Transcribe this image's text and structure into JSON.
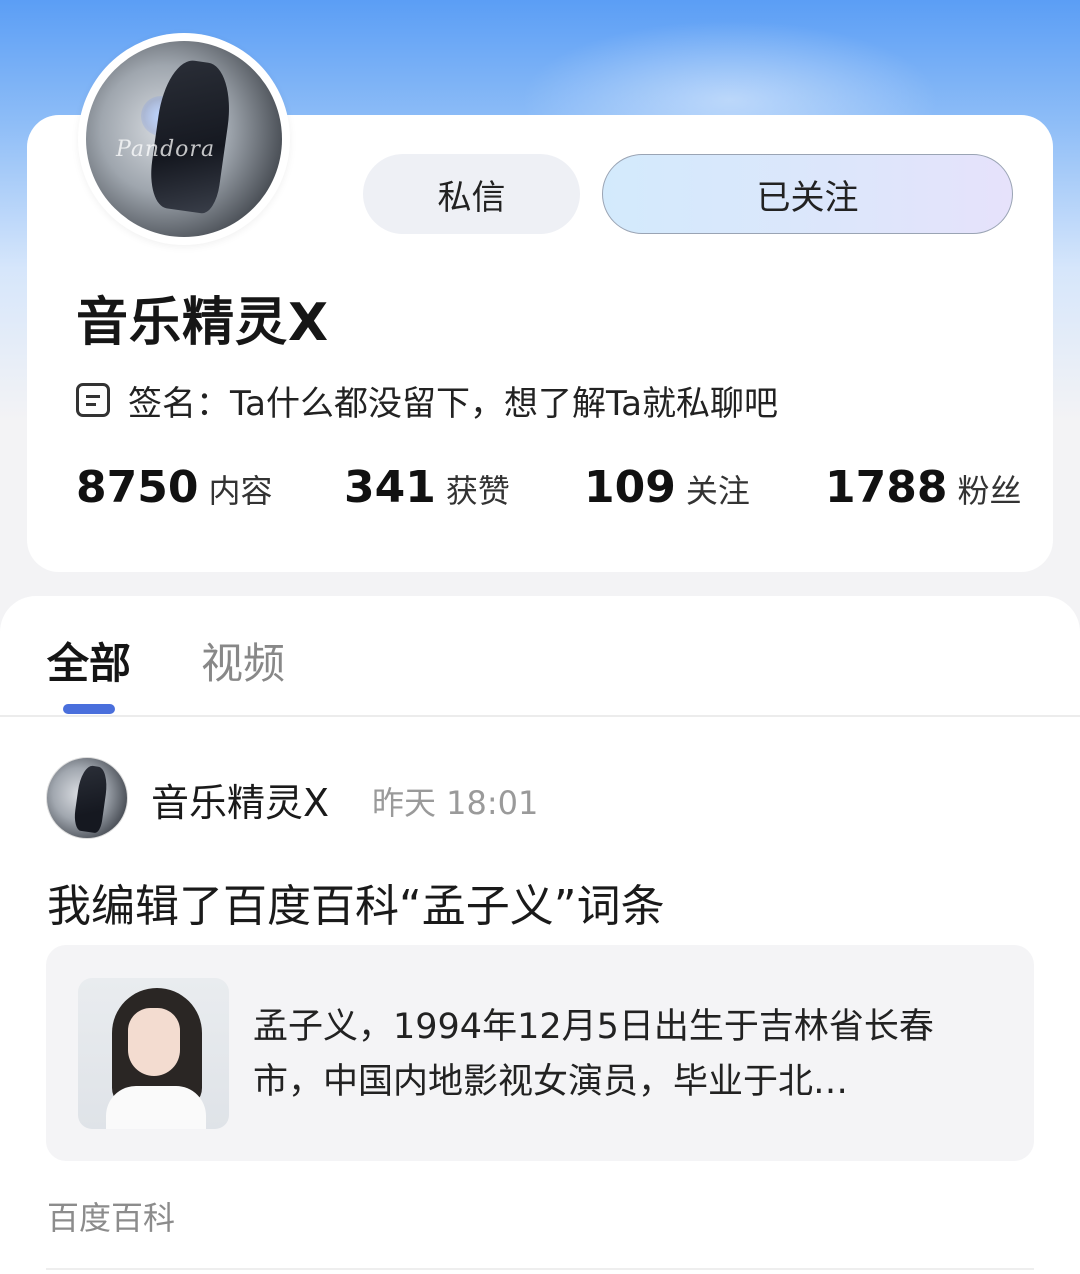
{
  "profile": {
    "username": "音乐精灵X",
    "buttons": {
      "message": "私信",
      "follow_state": "已关注"
    },
    "signature": {
      "label": "签名：",
      "text": "Ta什么都没留下，想了解Ta就私聊吧"
    },
    "stats": [
      {
        "value": "8750",
        "label": "内容"
      },
      {
        "value": "341",
        "label": "获赞"
      },
      {
        "value": "109",
        "label": "关注"
      },
      {
        "value": "1788",
        "label": "粉丝"
      }
    ]
  },
  "tabs": [
    {
      "label": "全部",
      "active": true
    },
    {
      "label": "视频",
      "active": false
    }
  ],
  "post": {
    "author": "音乐精灵X",
    "time": "昨天 18:01",
    "title": "我编辑了百度百科“孟子义”词条",
    "link_card": {
      "description": "孟子义，1994年12月5日出生于吉林省长春市，中国内地影视女演员，毕业于北…"
    },
    "source": "百度百科"
  },
  "colors": {
    "accent": "#4a6fdc",
    "header_gradient_top": "#5b9ef5",
    "page_bg": "#f3f3f5"
  },
  "icons": {
    "signature": "document-icon"
  }
}
